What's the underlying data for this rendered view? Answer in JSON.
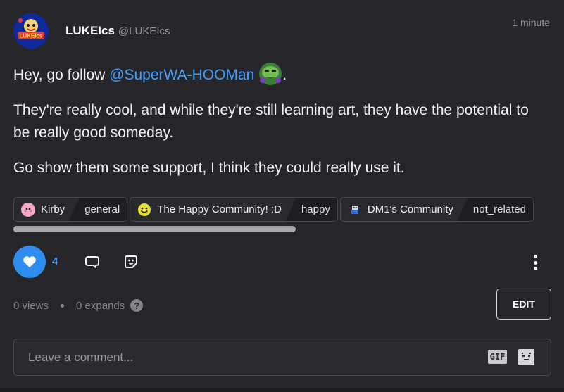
{
  "post": {
    "author_name": "LUKEIcs",
    "author_handle": "@LUKEIcs",
    "timestamp": "1 minute",
    "avatar_text": "LUKEIcs",
    "body": {
      "line1_prefix": "Hey, go follow ",
      "mention": "@SuperWA-HOOMan",
      "line1_suffix": ".",
      "paragraph2": "They're really cool, and while they're still learning art, they have the potential to be really good someday.",
      "paragraph3": "Go show them some support, I think they could really use it."
    }
  },
  "communities": [
    {
      "name": "Kirby",
      "tag": "general",
      "icon": "kirby-icon",
      "icon_color": "#f7a8c8"
    },
    {
      "name": "The Happy Community! :D",
      "tag": "happy",
      "icon": "smiley-icon",
      "icon_color": "#e8e02a"
    },
    {
      "name": "DM1's Community",
      "tag": "not_related",
      "icon": "dm1-community-icon",
      "icon_color": "#3a6fd8"
    }
  ],
  "actions": {
    "like_count": "4",
    "like_icon": "heart-icon",
    "comment_icon": "comment-icon",
    "share_icon": "sticker-icon",
    "more_icon": "more-vertical-icon"
  },
  "stats": {
    "views": "0 views",
    "expands": "0 expands",
    "help_icon": "?"
  },
  "edit_label": "EDIT",
  "comment": {
    "placeholder": "Leave a comment...",
    "gif_label": "GIF"
  },
  "colors": {
    "background": "#262529",
    "accent": "#2f8df0",
    "mention": "#3fa0ff"
  }
}
